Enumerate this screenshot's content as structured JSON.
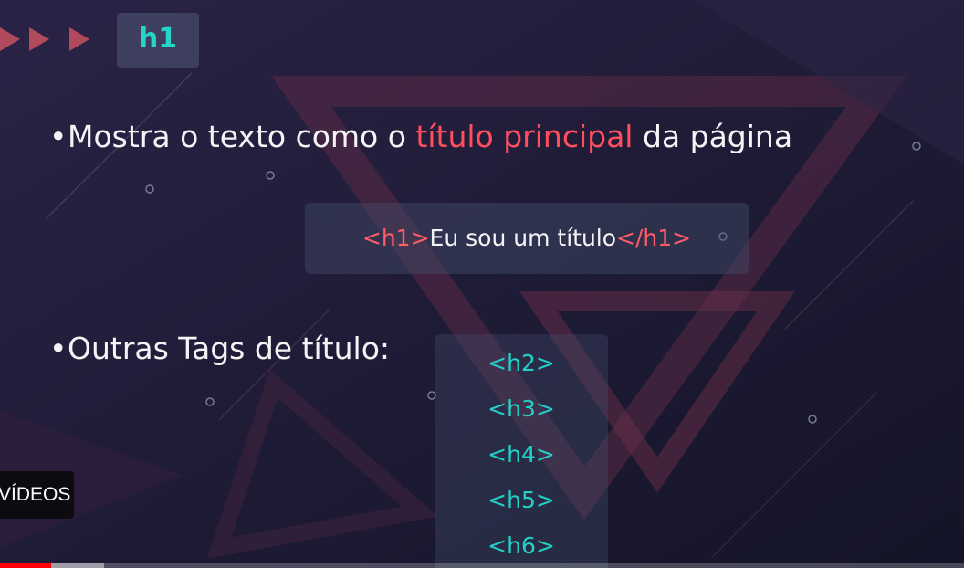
{
  "slide": {
    "badge": "h1",
    "line1": {
      "before": "Mostra o texto como o ",
      "highlight": "título principal",
      "after": " da página"
    },
    "code_example": {
      "open_tag": "<h1>",
      "text": "Eu sou um título",
      "close_tag": "</h1>"
    },
    "line2": "Outras Tags de título:",
    "other_tags": [
      "<h2>",
      "<h3>",
      "<h4>",
      "<h5>",
      "<h6>"
    ]
  },
  "player": {
    "videos_button": "VÍDEOS",
    "progress_played": 0.053,
    "progress_buffered": 0.108
  },
  "colors": {
    "accent": "#ff4f5e",
    "teal": "#23d0c6",
    "background": "#1b1a33"
  }
}
